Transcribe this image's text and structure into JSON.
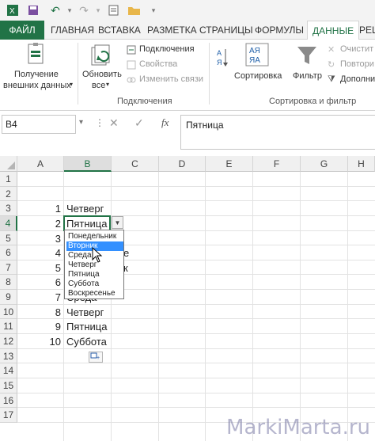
{
  "tabs": {
    "file": "ФАЙЛ",
    "home": "ГЛАВНАЯ",
    "insert": "ВСТАВКА",
    "page_layout": "РАЗМЕТКА СТРАНИЦЫ",
    "formulas": "ФОРМУЛЫ",
    "data": "ДАННЫЕ",
    "review": "РЕЦ"
  },
  "ribbon": {
    "get_external_1": "Получение",
    "get_external_2": "внешних данных",
    "refresh_1": "Обновить",
    "refresh_2": "все",
    "connections": "Подключения",
    "properties": "Свойства",
    "edit_links": "Изменить связи",
    "connections_group": "Подключения",
    "sort": "Сортировка",
    "filter": "Фильтр",
    "clear": "Очистит",
    "reapply": "Повтори",
    "advanced": "Дополни",
    "sort_filter_group": "Сортировка и фильтр",
    "az_icon": "АЯ"
  },
  "formula_bar": {
    "name_box": "B4",
    "value": "Пятница"
  },
  "columns": [
    "A",
    "B",
    "C",
    "D",
    "E",
    "F",
    "G",
    "H"
  ],
  "rows": [
    "1",
    "2",
    "3",
    "4",
    "5",
    "6",
    "7",
    "8",
    "9",
    "10",
    "11",
    "12",
    "13",
    "14",
    "15",
    "16",
    "17"
  ],
  "cells": {
    "a3": "1",
    "b3": "Четверг",
    "a4": "2",
    "b4": "Пятница",
    "a5": "3",
    "a6": "4",
    "a7": "5",
    "a8": "6",
    "a9": "7",
    "b9": "Среда",
    "a10": "8",
    "b10": "Четверг",
    "a11": "9",
    "b11": "Пятница",
    "a12": "10",
    "b12": "Суббота",
    "b6_tail": "е",
    "b7_tail": "к"
  },
  "dropdown": {
    "items": [
      "Понедельник",
      "Вторник",
      "Среда",
      "Четверг",
      "Пятница",
      "Суббота",
      "Воскресенье"
    ],
    "highlighted": "Вторник"
  },
  "watermark": "MarkiMarta.ru",
  "colors": {
    "accent": "#217346",
    "highlight": "#3390ff"
  }
}
